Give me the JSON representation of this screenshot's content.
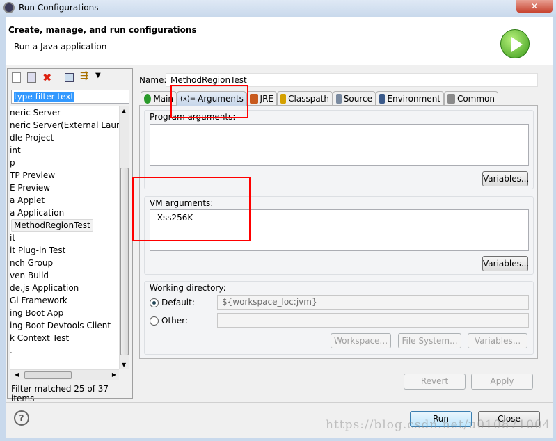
{
  "window": {
    "title": "Run Configurations"
  },
  "header": {
    "title": "Create, manage, and run configurations",
    "subtitle": "Run a Java application"
  },
  "sidebar": {
    "filter_placeholder": "type filter text",
    "items": [
      "neric Server",
      "neric Server(External Launch)",
      "dle Project",
      "int",
      "p",
      "TP Preview",
      "E Preview",
      "a Applet",
      "a Application",
      "MethodRegionTest",
      "it",
      "it Plug-in Test",
      "nch Group",
      "ven Build",
      "de.js Application",
      "Gi Framework",
      "ing Boot App",
      "ing Boot Devtools Client",
      "k Context Test",
      "."
    ],
    "selected": "MethodRegionTest",
    "status": "Filter matched 25 of 37 items"
  },
  "main": {
    "name_label": "Name:",
    "name_value": "MethodRegionTest",
    "tabs": [
      {
        "label": "Main",
        "icon": "main-c-icon"
      },
      {
        "label": "Arguments",
        "prefix": "(x)=",
        "icon": "arguments-icon"
      },
      {
        "label": "JRE",
        "icon": "jre-books-icon"
      },
      {
        "label": "Classpath",
        "icon": "classpath-icon"
      },
      {
        "label": "Source",
        "icon": "source-icon"
      },
      {
        "label": "Environment",
        "icon": "environment-icon"
      },
      {
        "label": "Common",
        "icon": "common-table-icon"
      }
    ],
    "active_tab": "Arguments",
    "program_args": {
      "label": "Program arguments:",
      "value": "",
      "variables": "Variables..."
    },
    "vm_args": {
      "label": "VM arguments:",
      "value": "-Xss256K",
      "variables": "Variables..."
    },
    "working_dir": {
      "label": "Working directory:",
      "default_label": "Default:",
      "default_value": "${workspace_loc:jvm}",
      "other_label": "Other:",
      "other_value": "",
      "default_selected": true,
      "buttons": [
        "Workspace...",
        "File System...",
        "Variables..."
      ]
    },
    "revert": "Revert",
    "apply": "Apply"
  },
  "footer": {
    "run": "Run",
    "close": "Close"
  },
  "watermark": "https://blog.csdn.net/u010871004",
  "colors": {
    "highlight": "#ff0000",
    "selection": "#3399ff"
  }
}
